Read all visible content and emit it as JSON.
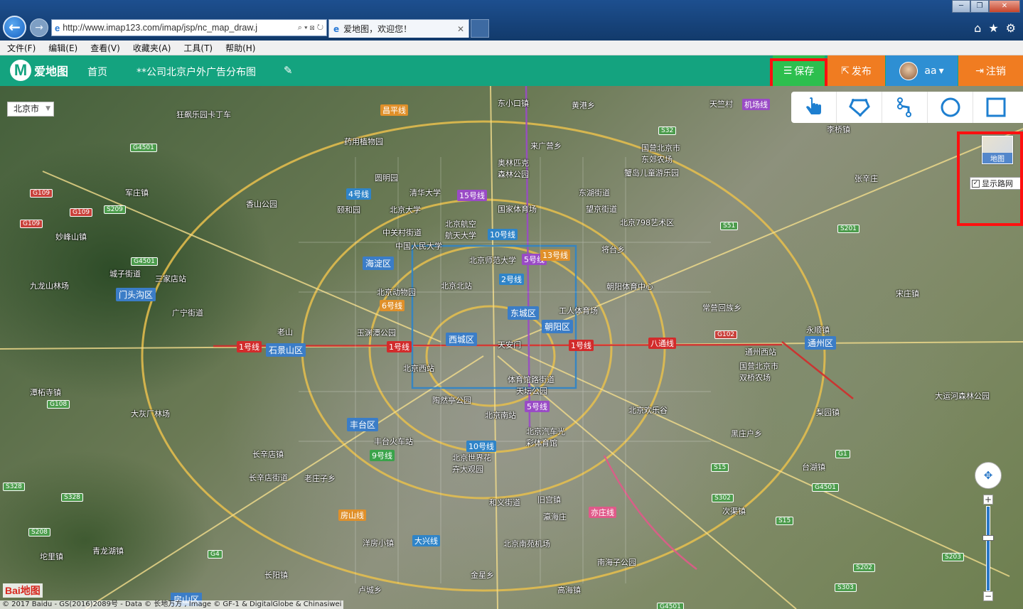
{
  "browser": {
    "url": "http://www.imap123.com/imap/jsp/nc_map_draw.j",
    "tab_title": "爱地图，欢迎您！",
    "menu": [
      "文件(F)",
      "编辑(E)",
      "查看(V)",
      "收藏夹(A)",
      "工具(T)",
      "帮助(H)"
    ]
  },
  "header": {
    "logo_text": "爱地图",
    "home": "首页",
    "map_title": "**公司北京户外广告分布图",
    "save": "保存",
    "publish": "发布",
    "user": "aa",
    "logout": "注销"
  },
  "map": {
    "city": "北京市",
    "map_type": "地图",
    "road_network": "显示路网",
    "copyright": "© 2017 Baidu - GS(2016)2089号 - Data © 长地万方 , Image © GF-1 & DigitalGlobe & Chinasiwei",
    "baidu_logo": "Bai地图",
    "districts": [
      "海淀区",
      "门头沟区",
      "石景山区",
      "西城区",
      "东城区",
      "朝阳区",
      "丰台区",
      "通州区",
      "房山区"
    ],
    "places": [
      "狂飙乐园卡丁车",
      "东小口镇",
      "黄港乡",
      "天竺村",
      "药用植物园",
      "来广营乡",
      "国营北京市东郊农场",
      "李桥镇",
      "奥林匹克森林公园",
      "圆明园",
      "清华大学",
      "东湖街道",
      "蟹岛儿童游乐园",
      "张辛庄",
      "香山公园",
      "颐和园",
      "北京大学",
      "国家体育场",
      "望京街道",
      "中关村街道",
      "北京航空航天大学",
      "北京798艺术区",
      "中国人民大学",
      "北京师范大学",
      "将台乡",
      "北京北站",
      "三家店站",
      "朝阳体育中心",
      "宋庄镇",
      "九龙山林场",
      "城子街道",
      "北京动物园",
      "工人体育场",
      "常营回族乡",
      "广宁街道",
      "玉渊潭公园",
      "老山",
      "天安门",
      "永顺镇",
      "通州西站",
      "北京西站",
      "体育馆路街道",
      "天坛公园",
      "国营北京市双桥农场",
      "潭柘寺镇",
      "陶然亭公园",
      "北京南站",
      "北京欢乐谷",
      "梨园镇",
      "大灰厂林场",
      "丰台火车站",
      "北京汽车光彩体育馆",
      "黑庄户乡",
      "长辛店镇",
      "北京世界花卉大观园",
      "台湖镇",
      "长辛店街道",
      "老庄子乡",
      "和义街道",
      "旧宫镇",
      "瀛海庄",
      "次渠镇",
      "洋房小镇",
      "北京南苑机场",
      "南海子公园",
      "青龙湖镇",
      "坨里镇",
      "长阳镇",
      "金星乡",
      "高海镇",
      "卢城乡",
      "大运河森林公园",
      "妙峰山镇",
      "军庄镇"
    ],
    "lines": [
      "1号线",
      "1号线",
      "1号线",
      "2号线",
      "4号线",
      "5号线",
      "5号线",
      "6号线",
      "9号线",
      "10号线",
      "10号线",
      "15号线",
      "八通线",
      "亦庄线",
      "房山线",
      "大兴线",
      "机场线",
      "昌平线",
      "13号线"
    ],
    "highways": [
      "G4501",
      "G109",
      "G109",
      "G109",
      "S209",
      "G4501",
      "G108",
      "S328",
      "S328",
      "G4",
      "S32",
      "S51",
      "S201",
      "G102",
      "G1",
      "S15",
      "S302",
      "S15",
      "S202",
      "S203",
      "S303",
      "S208",
      "G4501",
      "G4501"
    ]
  }
}
